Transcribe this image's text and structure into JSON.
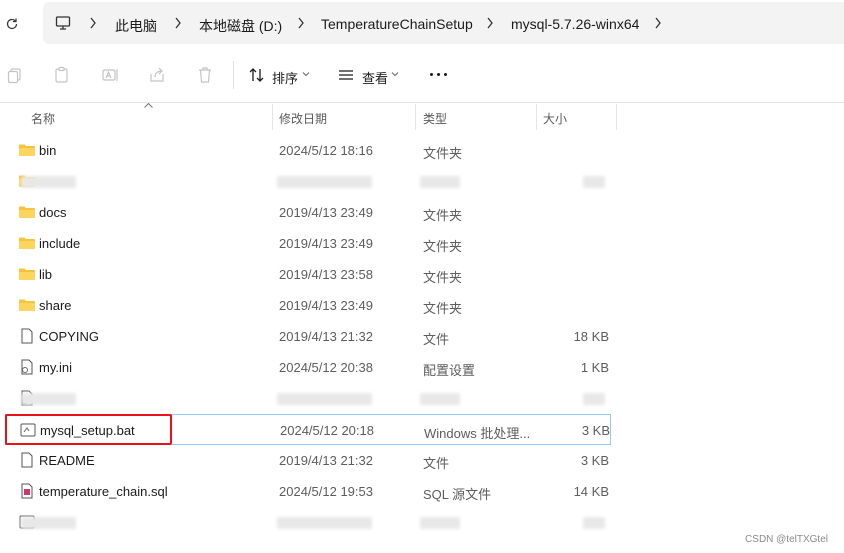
{
  "breadcrumbs": [
    "此电脑",
    "本地磁盘 (D:)",
    "TemperatureChainSetup",
    "mysql-5.7.26-winx64"
  ],
  "toolbar": {
    "sort_label": "排序",
    "view_label": "查看"
  },
  "columns": {
    "name": "名称",
    "modified": "修改日期",
    "type": "类型",
    "size": "大小"
  },
  "rows": [
    {
      "name": "bin",
      "date": "2024/5/12 18:16",
      "type": "文件夹",
      "size": "",
      "icon": "folder-icon"
    },
    {
      "name": "",
      "date": "",
      "type": "",
      "size": "",
      "icon": "folder-icon",
      "blurred": true
    },
    {
      "name": "docs",
      "date": "2019/4/13 23:49",
      "type": "文件夹",
      "size": "",
      "icon": "folder-icon"
    },
    {
      "name": "include",
      "date": "2019/4/13 23:49",
      "type": "文件夹",
      "size": "",
      "icon": "folder-icon"
    },
    {
      "name": "lib",
      "date": "2019/4/13 23:58",
      "type": "文件夹",
      "size": "",
      "icon": "folder-icon"
    },
    {
      "name": "share",
      "date": "2019/4/13 23:49",
      "type": "文件夹",
      "size": "",
      "icon": "folder-icon"
    },
    {
      "name": "COPYING",
      "date": "2019/4/13 21:32",
      "type": "文件",
      "size": "18 KB",
      "icon": "document-icon"
    },
    {
      "name": "my.ini",
      "date": "2024/5/12 20:38",
      "type": "配置设置",
      "size": "1 KB",
      "icon": "settings-file-icon"
    },
    {
      "name": "",
      "date": "",
      "type": "",
      "size": "",
      "icon": "settings-file-icon",
      "blurred": true
    },
    {
      "name": "mysql_setup.bat",
      "date": "2024/5/12 20:18",
      "type": "Windows 批处理...",
      "size": "3 KB",
      "icon": "batch-file-icon",
      "selected": true
    },
    {
      "name": "README",
      "date": "2019/4/13 21:32",
      "type": "文件",
      "size": "3 KB",
      "icon": "document-icon"
    },
    {
      "name": "temperature_chain.sql",
      "date": "2024/5/12 19:53",
      "type": "SQL 源文件",
      "size": "14 KB",
      "icon": "sql-file-icon"
    },
    {
      "name": "",
      "date": "",
      "type": "",
      "size": "",
      "icon": "batch-file-icon",
      "blurred": true
    }
  ],
  "watermark": "CSDN @telTXGtel",
  "colors": {
    "highlight": "#e8121c",
    "selection_border": "#99c9ef",
    "folder": "#f8c33c"
  }
}
